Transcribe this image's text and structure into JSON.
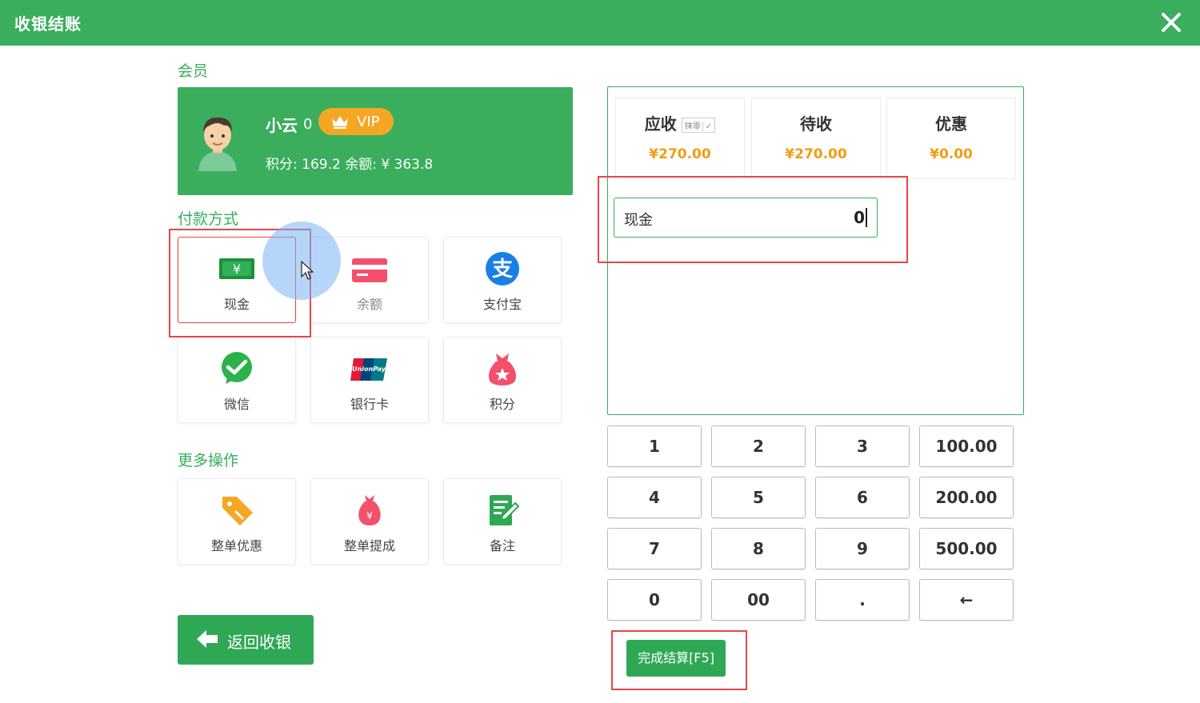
{
  "window": {
    "title": "收银结账"
  },
  "sections": {
    "member": "会员",
    "payment": "付款方式",
    "more": "更多操作"
  },
  "member": {
    "name": "小云",
    "count": "0",
    "vip_label": "VIP",
    "info": "积分: 169.2   余额: ¥ 363.8"
  },
  "payment_methods": [
    {
      "label": "现金",
      "icon": "cash-icon",
      "selected": true
    },
    {
      "label": "余额",
      "icon": "card-icon"
    },
    {
      "label": "支付宝",
      "icon": "alipay-icon"
    },
    {
      "label": "微信",
      "icon": "wechat-icon"
    },
    {
      "label": "银行卡",
      "icon": "unionpay-icon"
    },
    {
      "label": "积分",
      "icon": "points-bag-icon"
    }
  ],
  "more_actions": [
    {
      "label": "整单优惠",
      "icon": "tag-icon"
    },
    {
      "label": "整单提成",
      "icon": "money-bag-icon"
    },
    {
      "label": "备注",
      "icon": "note-icon"
    }
  ],
  "back_button": {
    "label": "返回收银"
  },
  "summary": {
    "receivable": {
      "label": "应收",
      "value": "¥270.00",
      "moling": "抹零",
      "moling_check": "✓"
    },
    "pending": {
      "label": "待收",
      "value": "¥270.00"
    },
    "discount": {
      "label": "优惠",
      "value": "¥0.00"
    }
  },
  "payment_input": {
    "label": "现金",
    "value": "0"
  },
  "keypad": [
    "1",
    "2",
    "3",
    "100.00",
    "4",
    "5",
    "6",
    "200.00",
    "7",
    "8",
    "9",
    "500.00",
    "0",
    "00",
    ".",
    "←"
  ],
  "finish_button": {
    "label": "完成结算[F5]"
  },
  "colors": {
    "primary": "#3aae5c",
    "accent": "#f39c12",
    "highlight": "#e94545"
  }
}
